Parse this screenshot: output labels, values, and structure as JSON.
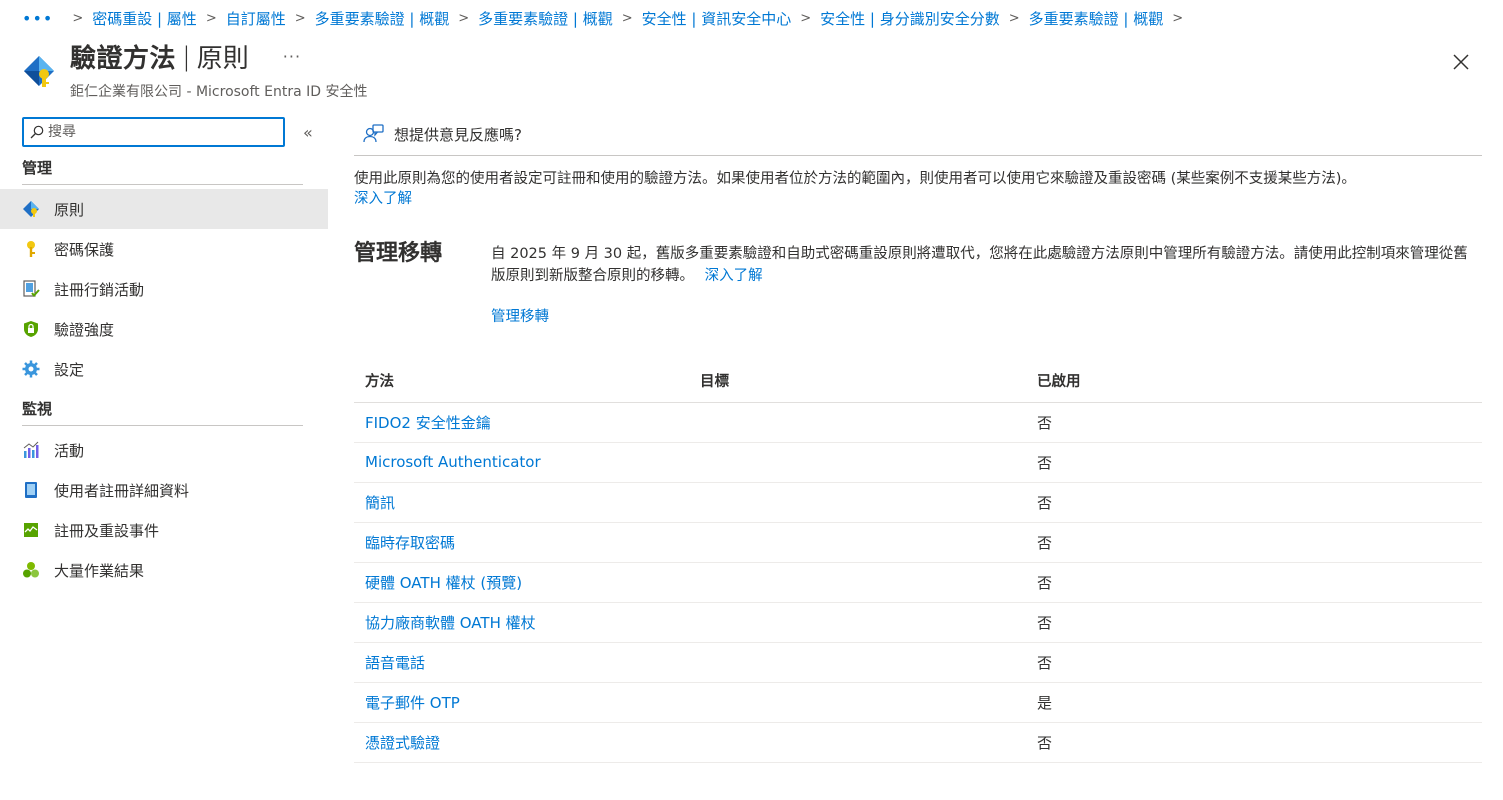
{
  "breadcrumb": {
    "items": [
      "密碼重設 | 屬性",
      "自訂屬性",
      "多重要素驗證 | 概觀",
      "多重要素驗證 | 概觀",
      "安全性 | 資訊安全中心",
      "安全性 | 身分識別安全分數",
      "多重要素驗證 | 概觀"
    ]
  },
  "header": {
    "title": "驗證方法",
    "separator": "|",
    "subtitle_page": "原則",
    "org": "鉅仁企業有限公司 - Microsoft Entra ID 安全性"
  },
  "sidebar": {
    "search_placeholder": "搜尋",
    "sections": [
      {
        "label": "管理",
        "items": [
          {
            "label": "原則",
            "icon": "policy-icon",
            "active": true
          },
          {
            "label": "密碼保護",
            "icon": "key-icon"
          },
          {
            "label": "註冊行銷活動",
            "icon": "registration-campaign-icon"
          },
          {
            "label": "驗證強度",
            "icon": "shield-lock-icon"
          },
          {
            "label": "設定",
            "icon": "gear-icon"
          }
        ]
      },
      {
        "label": "監視",
        "items": [
          {
            "label": "活動",
            "icon": "activity-chart-icon"
          },
          {
            "label": "使用者註冊詳細資料",
            "icon": "user-details-icon"
          },
          {
            "label": "註冊及重設事件",
            "icon": "events-icon"
          },
          {
            "label": "大量作業結果",
            "icon": "bulk-results-icon"
          }
        ]
      }
    ]
  },
  "main": {
    "feedback_label": "想提供意見反應嗎?",
    "description": "使用此原則為您的使用者設定可註冊和使用的驗證方法。如果使用者位於方法的範圍內，則使用者可以使用它來驗證及重設密碼 (某些案例不支援某些方法)。",
    "description_link": "深入了解",
    "migration": {
      "title": "管理移轉",
      "body": "自 2025 年 9 月 30 起，舊版多重要素驗證和自助式密碼重設原則將遭取代，您將在此處驗證方法原則中管理所有驗證方法。請使用此控制項來管理從舊版原則到新版整合原則的移轉。",
      "learn_more": "深入了解",
      "action_link": "管理移轉"
    },
    "table": {
      "headers": {
        "method": "方法",
        "target": "目標",
        "enabled": "已啟用"
      },
      "rows": [
        {
          "method": "FIDO2 安全性金鑰",
          "target": "",
          "enabled": "否"
        },
        {
          "method": "Microsoft Authenticator",
          "target": "",
          "enabled": "否"
        },
        {
          "method": "簡訊",
          "target": "",
          "enabled": "否"
        },
        {
          "method": "臨時存取密碼",
          "target": "",
          "enabled": "否"
        },
        {
          "method": "硬體 OATH 權杖 (預覽)",
          "target": "",
          "enabled": "否"
        },
        {
          "method": "協力廠商軟體 OATH 權杖",
          "target": "",
          "enabled": "否"
        },
        {
          "method": "語音電話",
          "target": "",
          "enabled": "否"
        },
        {
          "method": "電子郵件 OTP",
          "target": "",
          "enabled": "是"
        },
        {
          "method": "憑證式驗證",
          "target": "",
          "enabled": "否"
        }
      ]
    }
  },
  "colors": {
    "accent": "#0078d4",
    "text": "#323130",
    "active_bg": "#e8e8e8"
  }
}
